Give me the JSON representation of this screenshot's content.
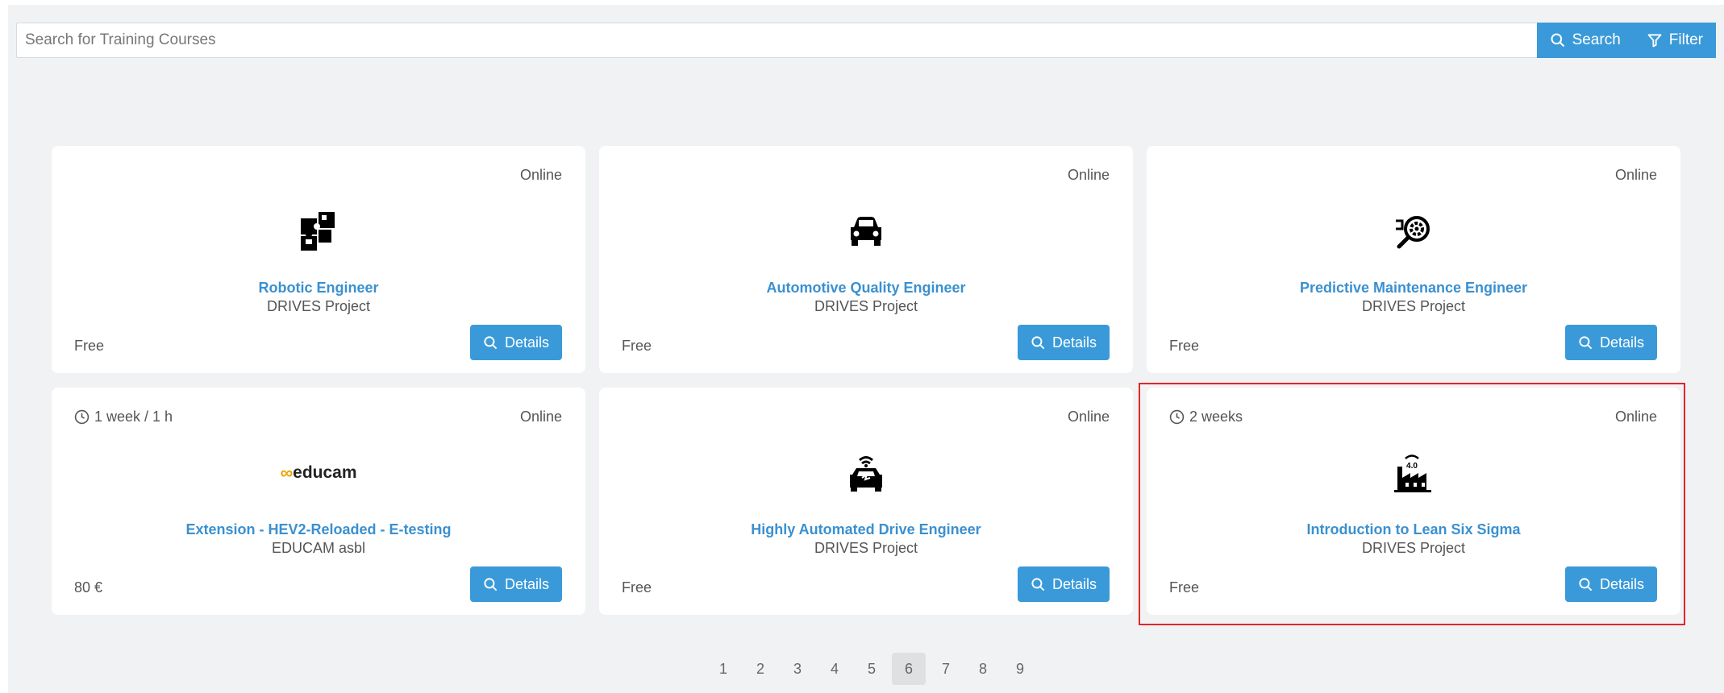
{
  "search": {
    "placeholder": "Search for Training Courses",
    "search_label": "Search",
    "filter_label": "Filter"
  },
  "cards": [
    {
      "mode": "Online",
      "duration": "",
      "title": "Robotic Engineer",
      "provider": "DRIVES Project",
      "price": "Free",
      "details": "Details",
      "icon": "puzzle-icon"
    },
    {
      "mode": "Online",
      "duration": "",
      "title": "Automotive Quality Engineer",
      "provider": "DRIVES Project",
      "price": "Free",
      "details": "Details",
      "icon": "car-icon"
    },
    {
      "mode": "Online",
      "duration": "",
      "title": "Predictive Maintenance Engineer",
      "provider": "DRIVES Project",
      "price": "Free",
      "details": "Details",
      "icon": "gear-search-icon"
    },
    {
      "mode": "Online",
      "duration": "1 week / 1 h",
      "title": "Extension - HEV2-Reloaded - E-testing",
      "provider": "EDUCAM asbl",
      "price": "80 €",
      "details": "Details",
      "icon": "educam-logo",
      "logo_text": "educam"
    },
    {
      "mode": "Online",
      "duration": "",
      "title": "Highly Automated Drive Engineer",
      "provider": "DRIVES Project",
      "price": "Free",
      "details": "Details",
      "icon": "connected-car-icon"
    },
    {
      "mode": "Online",
      "duration": "2 weeks",
      "title": "Introduction to Lean Six Sigma",
      "provider": "DRIVES Project",
      "price": "Free",
      "details": "Details",
      "icon": "smart-factory-icon",
      "icon_text": "4.0"
    }
  ],
  "pagination": {
    "pages": [
      "1",
      "2",
      "3",
      "4",
      "5",
      "6",
      "7",
      "8",
      "9"
    ],
    "current": "6"
  },
  "colors": {
    "accent": "#3a9ad9",
    "title": "#3a90d0",
    "highlight": "#e0262a"
  }
}
